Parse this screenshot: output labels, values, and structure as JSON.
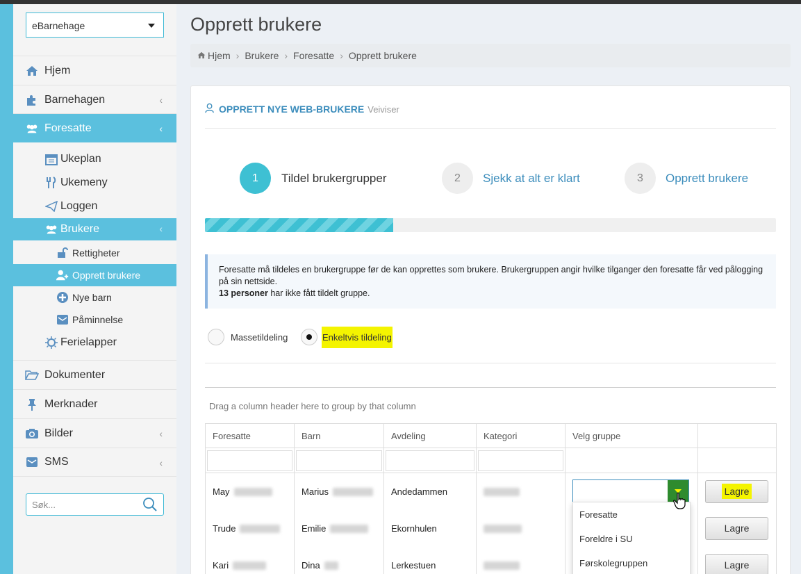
{
  "sidebar": {
    "brand": "eBarnehage",
    "nav": [
      {
        "label": "Hjem",
        "icon": "home-icon"
      },
      {
        "label": "Barnehagen",
        "icon": "puzzle-icon"
      },
      {
        "label": "Foresatte",
        "icon": "users-icon"
      },
      {
        "label": "Dokumenter",
        "icon": "folder-icon"
      },
      {
        "label": "Merknader",
        "icon": "pin-icon"
      },
      {
        "label": "Bilder",
        "icon": "camera-icon"
      },
      {
        "label": "SMS",
        "icon": "envelope-icon"
      }
    ],
    "sub": [
      {
        "label": "Ukeplan",
        "icon": "calendar-icon"
      },
      {
        "label": "Ukemeny",
        "icon": "cutlery-icon"
      },
      {
        "label": "Loggen",
        "icon": "paper-plane-icon"
      },
      {
        "label": "Brukere",
        "icon": "users-icon"
      },
      {
        "label": "Ferielapper",
        "icon": "sun-icon"
      }
    ],
    "sub2": [
      {
        "label": "Rettigheter",
        "icon": "unlock-icon"
      },
      {
        "label": "Opprett brukere",
        "icon": "user-plus-icon"
      },
      {
        "label": "Nye barn",
        "icon": "plus-circle-icon"
      },
      {
        "label": "Påminnelse",
        "icon": "envelope-icon"
      }
    ],
    "search_placeholder": "Søk..."
  },
  "page": {
    "title": "Opprett brukere",
    "breadcrumb": [
      "Hjem",
      "Brukere",
      "Foresatte",
      "Opprett brukere"
    ]
  },
  "panel": {
    "heading": "OPPRETT NYE WEB-BRUKERE",
    "heading_sub": "Veiviser",
    "steps": [
      {
        "num": "1",
        "label": "Tildel brukergrupper"
      },
      {
        "num": "2",
        "label": "Sjekk at alt er klart"
      },
      {
        "num": "3",
        "label": "Opprett brukere"
      }
    ],
    "progress": 0.33,
    "info_text": "Foresatte må tildeles en brukergruppe før de kan opprettes som brukere. Brukergruppen angir hvilke tilganger den foresatte får ved pålogging på sin nettside.",
    "info_count": "13 personer",
    "info_count_rest": " har ikke fått tildelt gruppe.",
    "radio_mass": "Massetildeling",
    "radio_single": "Enkeltvis tildeling",
    "group_hint": "Drag a column header here to group by that column"
  },
  "grid": {
    "columns": [
      "Foresatte",
      "Barn",
      "Avdeling",
      "Kategori",
      "Velg gruppe",
      ""
    ],
    "rows": [
      {
        "foresatt": "May",
        "barn": "Marius",
        "avdeling": "Andedammen"
      },
      {
        "foresatt": "Trude",
        "barn": "Emilie",
        "avdeling": "Ekornhulen"
      },
      {
        "foresatt": "Kari",
        "barn": "Dina",
        "avdeling": "Lerkestuen"
      }
    ],
    "save_label": "Lagre",
    "dropdown_options": [
      "Foresatte",
      "Foreldre i SU",
      "Førskolegruppen"
    ]
  },
  "colors": {
    "accent": "#5bc0de",
    "highlight": "#f4f400",
    "link": "#3c8dbc"
  }
}
